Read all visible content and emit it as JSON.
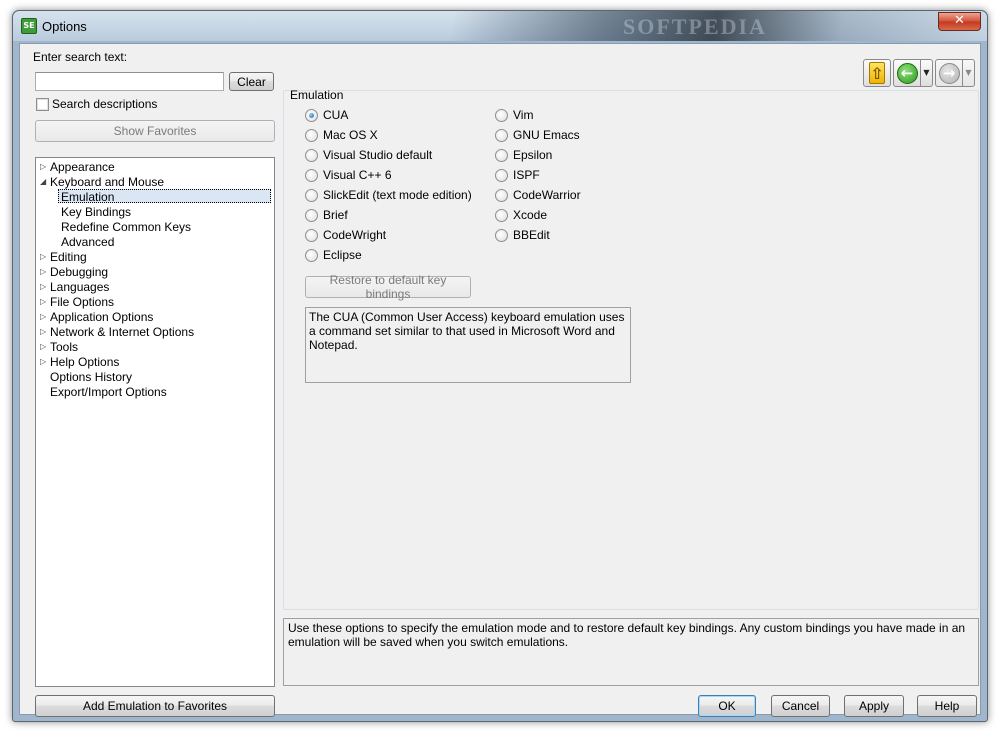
{
  "window": {
    "title": "Options",
    "app_icon": "SE",
    "watermark": "SOFTPEDIA",
    "close_glyph": "✕"
  },
  "search": {
    "label": "Enter search text:",
    "value": "",
    "placeholder": "",
    "clear_label": "Clear",
    "descriptions_label": "Search descriptions",
    "descriptions_checked": false,
    "show_favorites_label": "Show Favorites"
  },
  "tree": {
    "items": [
      {
        "label": "Appearance",
        "expander": "collapsed"
      },
      {
        "label": "Keyboard and Mouse",
        "expander": "expanded"
      },
      {
        "label": "Emulation",
        "expander": "none",
        "selected": true
      },
      {
        "label": "Key Bindings",
        "expander": "none"
      },
      {
        "label": "Redefine Common Keys",
        "expander": "none"
      },
      {
        "label": "Advanced",
        "expander": "none"
      },
      {
        "label": "Editing",
        "expander": "collapsed"
      },
      {
        "label": "Debugging",
        "expander": "collapsed"
      },
      {
        "label": "Languages",
        "expander": "collapsed"
      },
      {
        "label": "File Options",
        "expander": "collapsed"
      },
      {
        "label": "Application Options",
        "expander": "collapsed"
      },
      {
        "label": "Network & Internet Options",
        "expander": "collapsed"
      },
      {
        "label": "Tools",
        "expander": "collapsed"
      },
      {
        "label": "Help Options",
        "expander": "collapsed"
      },
      {
        "label": "Options History",
        "expander": "none"
      },
      {
        "label": "Export/Import Options",
        "expander": "none"
      }
    ]
  },
  "toolbar": {
    "up_icon": "up-arrow-icon",
    "back_icon": "back-arrow-icon",
    "forward_icon": "forward-arrow-icon",
    "up_glyph": "⇧",
    "back_glyph": "←",
    "forward_glyph": "→",
    "dropdown_glyph": "▼"
  },
  "emulation": {
    "group_label": "Emulation",
    "left_options": [
      {
        "label": "CUA",
        "checked": true
      },
      {
        "label": "Mac OS X",
        "checked": false
      },
      {
        "label": "Visual Studio default",
        "checked": false
      },
      {
        "label": "Visual C++ 6",
        "checked": false
      },
      {
        "label": "SlickEdit (text mode edition)",
        "checked": false
      },
      {
        "label": "Brief",
        "checked": false
      },
      {
        "label": "CodeWright",
        "checked": false
      },
      {
        "label": "Eclipse",
        "checked": false
      }
    ],
    "right_options": [
      {
        "label": "Vim",
        "checked": false
      },
      {
        "label": "GNU Emacs",
        "checked": false
      },
      {
        "label": "Epsilon",
        "checked": false
      },
      {
        "label": "ISPF",
        "checked": false
      },
      {
        "label": "CodeWarrior",
        "checked": false
      },
      {
        "label": "Xcode",
        "checked": false
      },
      {
        "label": "BBEdit",
        "checked": false
      }
    ],
    "restore_label": "Restore to default key bindings",
    "description": "The CUA (Common User Access) keyboard emulation uses a command set similar to that used in Microsoft Word and Notepad."
  },
  "help_text": "Use these options to specify the emulation mode and to restore default key bindings. Any custom bindings you have made in an emulation will be saved when you switch emulations.",
  "footer": {
    "add_favorites_label": "Add Emulation to Favorites",
    "ok_label": "OK",
    "cancel_label": "Cancel",
    "apply_label": "Apply",
    "help_label": "Help"
  }
}
